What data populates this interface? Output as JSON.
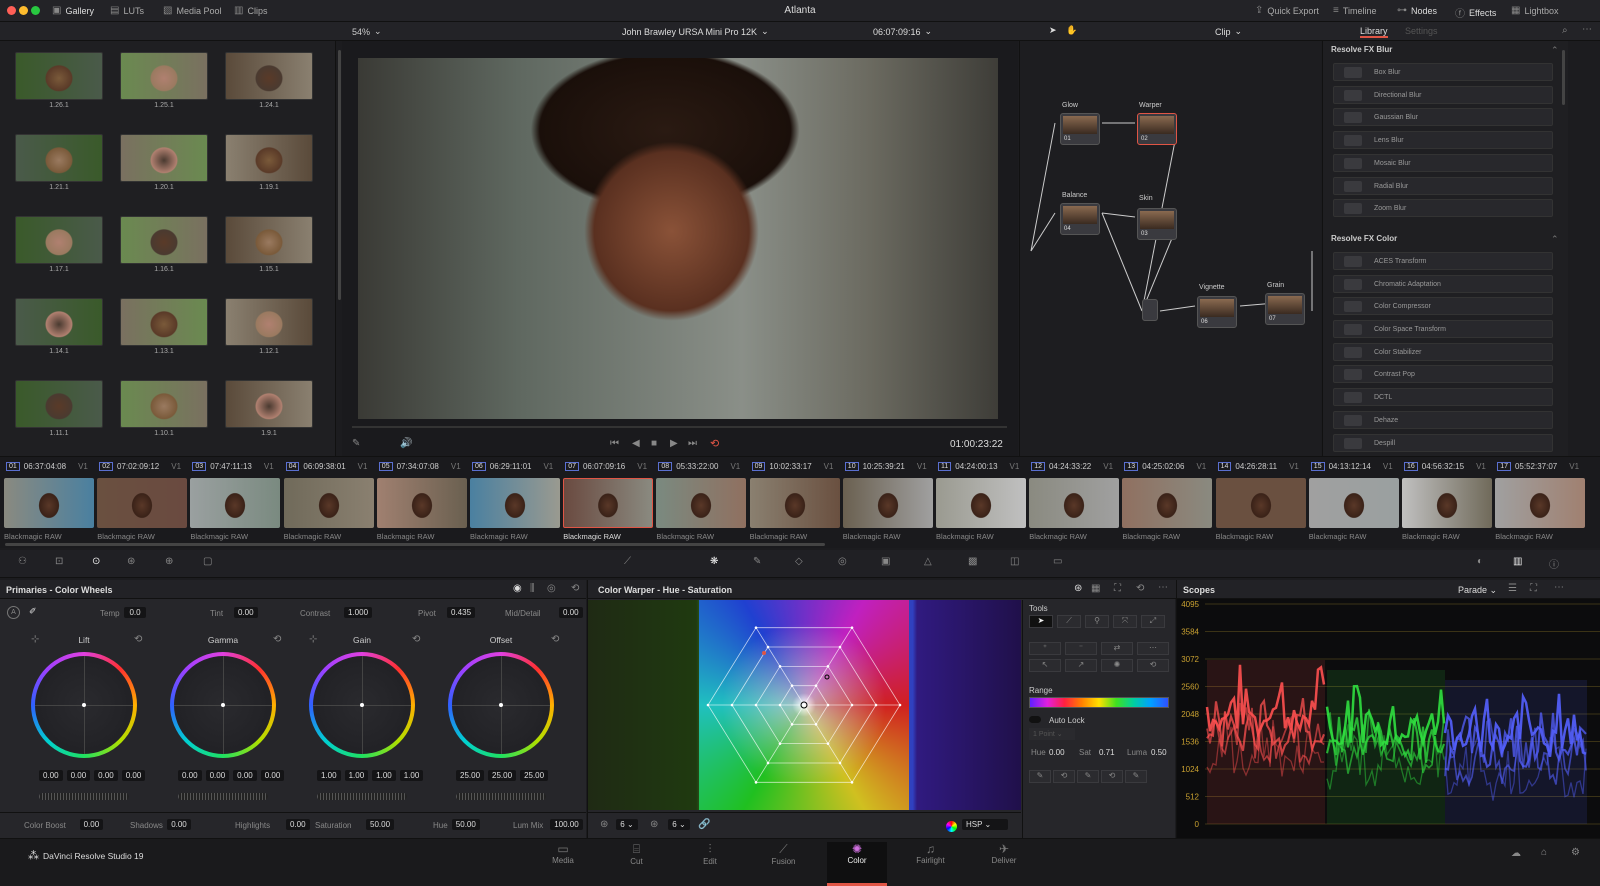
{
  "window": {
    "title": "Atlanta"
  },
  "topbar": {
    "left": [
      {
        "icon": "gallery-icon",
        "label": "Gallery"
      },
      {
        "icon": "luts-icon",
        "label": "LUTs"
      },
      {
        "icon": "media-pool-icon",
        "label": "Media Pool"
      },
      {
        "icon": "clips-icon",
        "label": "Clips"
      }
    ],
    "right": [
      {
        "icon": "export-icon",
        "label": "Quick Export"
      },
      {
        "icon": "timeline-icon",
        "label": "Timeline"
      },
      {
        "icon": "nodes-icon",
        "label": "Nodes"
      },
      {
        "icon": "fx-icon",
        "label": "Effects"
      },
      {
        "icon": "lightbox-icon",
        "label": "Lightbox"
      }
    ]
  },
  "toolbar": {
    "zoom": "54%",
    "timeline_name": "John Brawley URSA Mini Pro 12K",
    "timecode": "06:07:09:16",
    "node_mode": "Clip"
  },
  "gallery": {
    "stills": [
      "1.26.1",
      "1.25.1",
      "1.24.1",
      "1.21.1",
      "1.20.1",
      "1.19.1",
      "1.17.1",
      "1.16.1",
      "1.15.1",
      "1.14.1",
      "1.13.1",
      "1.12.1",
      "1.11.1",
      "1.10.1",
      "1.9.1"
    ]
  },
  "viewer": {
    "timecode": "01:00:23:22"
  },
  "nodes": [
    {
      "label": "Glow",
      "num": "01"
    },
    {
      "label": "Warper",
      "num": "02"
    },
    {
      "label": "Balance",
      "num": "04"
    },
    {
      "label": "Skin",
      "num": "03"
    },
    {
      "label": "Vignette",
      "num": "06"
    },
    {
      "label": "Grain",
      "num": "07"
    }
  ],
  "library": {
    "tabs": [
      "Library",
      "Settings"
    ],
    "sections": [
      {
        "title": "Resolve FX Blur",
        "items": [
          "Box Blur",
          "Directional Blur",
          "Gaussian Blur",
          "Lens Blur",
          "Mosaic Blur",
          "Radial Blur",
          "Zoom Blur"
        ]
      },
      {
        "title": "Resolve FX Color",
        "items": [
          "ACES Transform",
          "Chromatic Adaptation",
          "Color Compressor",
          "Color Space Transform",
          "Color Stabilizer",
          "Contrast Pop",
          "DCTL",
          "Dehaze",
          "Despill"
        ]
      }
    ]
  },
  "clips": [
    {
      "num": "01",
      "tc": "06:37:04:08"
    },
    {
      "num": "02",
      "tc": "07:02:09:12"
    },
    {
      "num": "03",
      "tc": "07:47:11:13"
    },
    {
      "num": "04",
      "tc": "06:09:38:01"
    },
    {
      "num": "05",
      "tc": "07:34:07:08"
    },
    {
      "num": "06",
      "tc": "06:29:11:01"
    },
    {
      "num": "07",
      "tc": "06:07:09:16"
    },
    {
      "num": "08",
      "tc": "05:33:22:00"
    },
    {
      "num": "09",
      "tc": "10:02:33:17"
    },
    {
      "num": "10",
      "tc": "10:25:39:21"
    },
    {
      "num": "11",
      "tc": "04:24:00:13"
    },
    {
      "num": "12",
      "tc": "04:24:33:22"
    },
    {
      "num": "13",
      "tc": "04:25:02:06"
    },
    {
      "num": "14",
      "tc": "04:26:28:11"
    },
    {
      "num": "15",
      "tc": "04:13:12:14"
    },
    {
      "num": "16",
      "tc": "04:56:32:15"
    },
    {
      "num": "17",
      "tc": "05:52:37:07"
    }
  ],
  "clip_track": "V1",
  "clip_codec": "Blackmagic RAW",
  "selected_clip": "07",
  "primaries": {
    "title": "Primaries - Color Wheels",
    "params": [
      {
        "label": "Temp",
        "value": "0.0"
      },
      {
        "label": "Tint",
        "value": "0.00"
      },
      {
        "label": "Contrast",
        "value": "1.000"
      },
      {
        "label": "Pivot",
        "value": "0.435"
      },
      {
        "label": "Mid/Detail",
        "value": "0.00"
      }
    ],
    "wheels": [
      {
        "label": "Lift",
        "values": [
          "0.00",
          "0.00",
          "0.00",
          "0.00"
        ]
      },
      {
        "label": "Gamma",
        "values": [
          "0.00",
          "0.00",
          "0.00",
          "0.00"
        ]
      },
      {
        "label": "Gain",
        "values": [
          "1.00",
          "1.00",
          "1.00",
          "1.00"
        ]
      },
      {
        "label": "Offset",
        "values": [
          "25.00",
          "25.00",
          "25.00"
        ]
      }
    ],
    "bottom": [
      {
        "label": "Color Boost",
        "value": "0.00"
      },
      {
        "label": "Shadows",
        "value": "0.00"
      },
      {
        "label": "Highlights",
        "value": "0.00"
      },
      {
        "label": "Saturation",
        "value": "50.00"
      },
      {
        "label": "Hue",
        "value": "50.00"
      },
      {
        "label": "Lum Mix",
        "value": "100.00"
      }
    ]
  },
  "warper": {
    "title": "Color Warper - Hue - Saturation",
    "grid1": "6",
    "grid2": "6",
    "mode": "HSP"
  },
  "tools": {
    "title": "Tools",
    "range": "Range",
    "auto_lock": "Auto Lock",
    "point": "1 Point",
    "hue_label": "Hue",
    "hue": "0.00",
    "sat_label": "Sat",
    "sat": "0.71",
    "luma_label": "Luma",
    "luma": "0.50"
  },
  "scopes": {
    "title": "Scopes",
    "mode": "Parade",
    "ticks": [
      "4095",
      "3584",
      "3072",
      "2560",
      "2048",
      "1536",
      "1024",
      "512",
      "0"
    ]
  },
  "app": {
    "name": "DaVinci Resolve Studio 19"
  },
  "pages": [
    {
      "label": "Media",
      "icon": "media-page-icon"
    },
    {
      "label": "Cut",
      "icon": "cut-page-icon"
    },
    {
      "label": "Edit",
      "icon": "edit-page-icon"
    },
    {
      "label": "Fusion",
      "icon": "fusion-page-icon"
    },
    {
      "label": "Color",
      "icon": "color-page-icon"
    },
    {
      "label": "Fairlight",
      "icon": "fairlight-page-icon"
    },
    {
      "label": "Deliver",
      "icon": "deliver-page-icon"
    }
  ],
  "active_page": "Color",
  "colors": {
    "accent": "#e05545",
    "node_link": "#8fd14f",
    "clip_num": "#5a6fd0"
  }
}
